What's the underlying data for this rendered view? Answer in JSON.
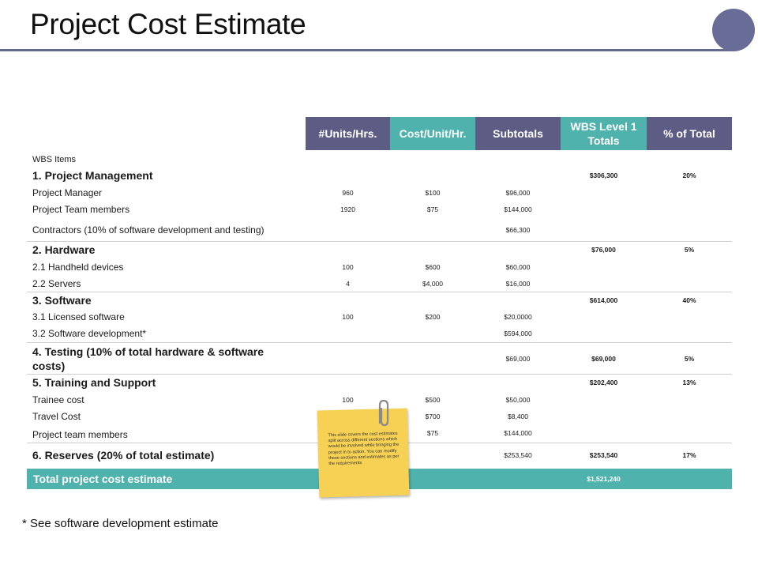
{
  "title": "Project Cost Estimate",
  "headers": {
    "units": "#Units/Hrs.",
    "cost": "Cost/Unit/Hr.",
    "subtotal": "Subtotals",
    "wbs": "WBS Level 1 Totals",
    "pct": "% of Total"
  },
  "wbs_items_label": "WBS Items",
  "sections": [
    {
      "name": "1. Project Management",
      "wbs": "$306,300",
      "pct": "20%",
      "items": [
        {
          "label": "Project Manager",
          "units": "960",
          "cost": "$100",
          "subtotal": "$96,000"
        },
        {
          "label": "Project Team members",
          "units": "1920",
          "cost": "$75",
          "subtotal": "$144,000"
        },
        {
          "label": "Contractors (10% of software development and testing)",
          "units": "",
          "cost": "",
          "subtotal": "$66,300"
        }
      ]
    },
    {
      "name": "2. Hardware",
      "wbs": "$76,000",
      "pct": "5%",
      "items": [
        {
          "label": "2.1 Handheld devices",
          "units": "100",
          "cost": "$600",
          "subtotal": "$60,000"
        },
        {
          "label": "2.2 Servers",
          "units": "4",
          "cost": "$4,000",
          "subtotal": "$16,000"
        }
      ]
    },
    {
      "name": "3. Software",
      "wbs": "$614,000",
      "pct": "40%",
      "items": [
        {
          "label": "3.1 Licensed software",
          "units": "100",
          "cost": "$200",
          "subtotal": "$20,0000"
        },
        {
          "label": "3.2 Software development*",
          "units": "",
          "cost": "",
          "subtotal": "$594,000"
        }
      ]
    },
    {
      "name": "4. Testing (10% of total hardware & software costs)",
      "subtotal": "$69,000",
      "wbs": "$69,000",
      "pct": "5%",
      "items": []
    },
    {
      "name": "5. Training and Support",
      "wbs": "$202,400",
      "pct": "13%",
      "items": [
        {
          "label": "Trainee cost",
          "units": "100",
          "cost": "$500",
          "subtotal": "$50,000"
        },
        {
          "label": "Travel Cost",
          "units": "",
          "cost": "$700",
          "subtotal": "$8,400"
        },
        {
          "label": "Project team members",
          "units": "",
          "cost": "$75",
          "subtotal": "$144,000"
        }
      ]
    },
    {
      "name": "6. Reserves (20% of total estimate)",
      "subtotal": "$253,540",
      "wbs": "$253,540",
      "pct": "17%",
      "items": []
    }
  ],
  "total": {
    "label": "Total project cost estimate",
    "value": "$1,521,240"
  },
  "note": "This slide covers the cost estimates split across different sections which would be involved while bringing the project in to action. You can modify these sections and estimates as per the requirements",
  "footnote": "* See software development estimate",
  "colors": {
    "purple": "#5d5c85",
    "teal": "#4fb2ad",
    "note": "#f6d154"
  },
  "icons": [
    "paperclip-icon"
  ]
}
